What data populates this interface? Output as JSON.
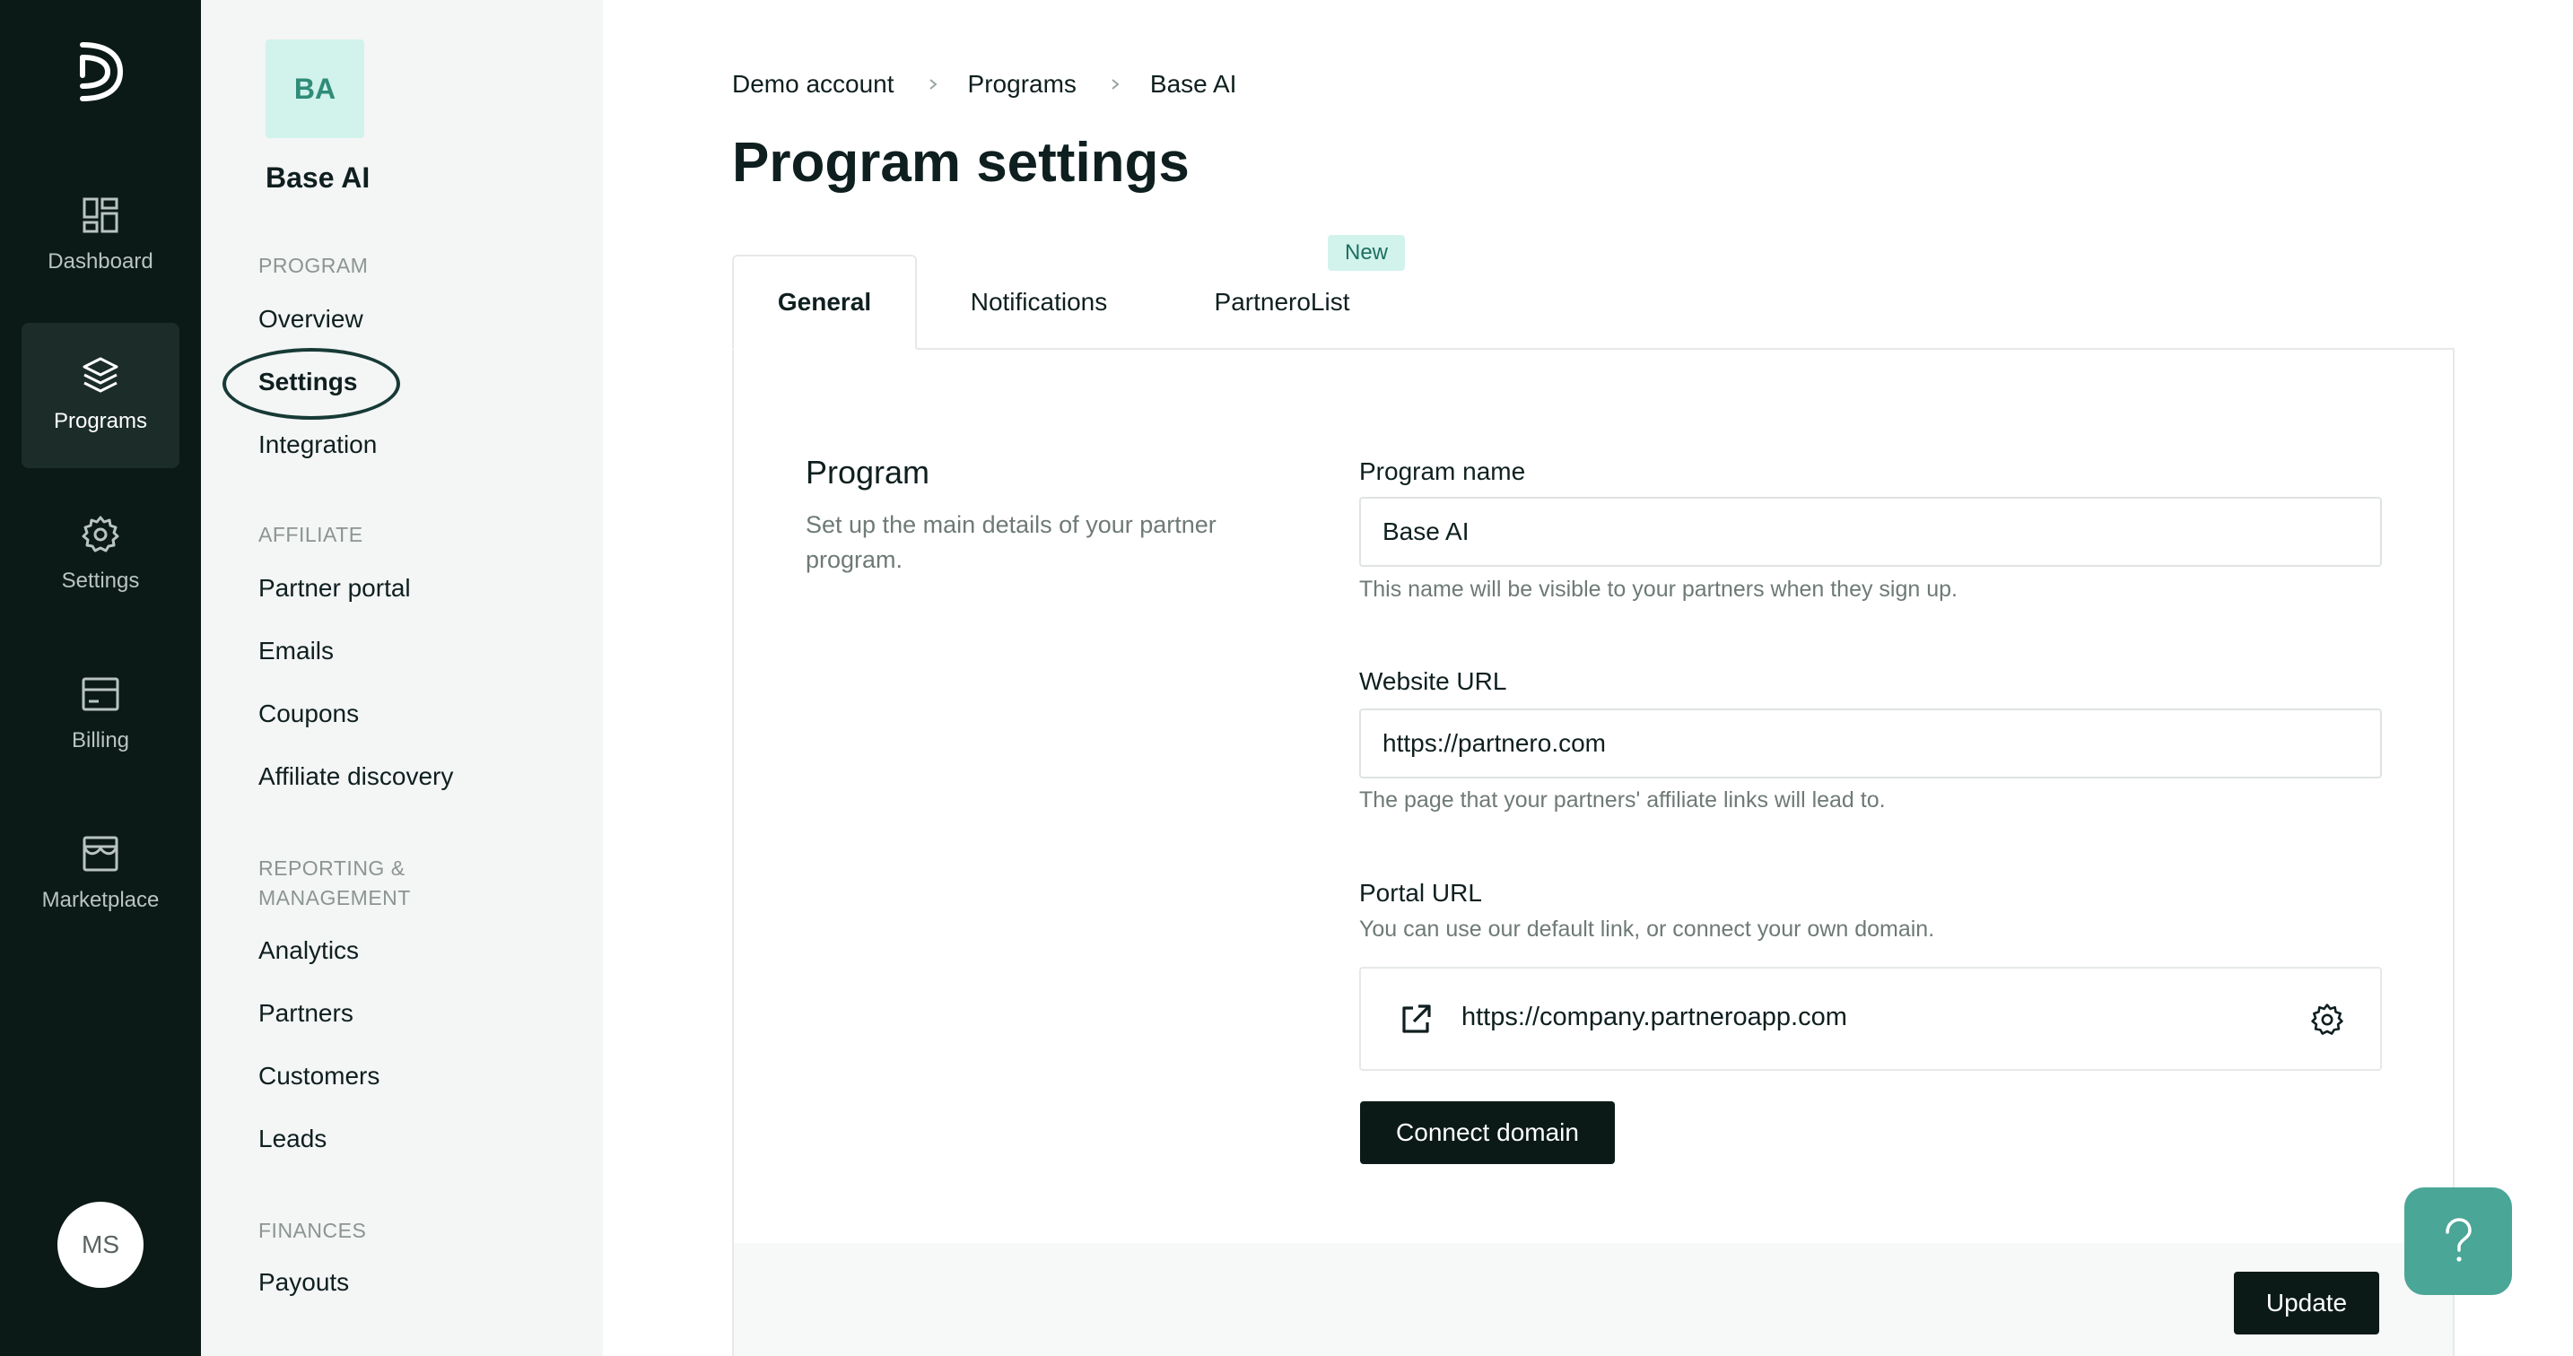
{
  "rail": {
    "items": [
      {
        "label": "Dashboard",
        "icon": "dashboard-icon",
        "active": false
      },
      {
        "label": "Programs",
        "icon": "layers-icon",
        "active": true
      },
      {
        "label": "Settings",
        "icon": "gear-icon",
        "active": false
      },
      {
        "label": "Billing",
        "icon": "billing-icon",
        "active": false
      },
      {
        "label": "Marketplace",
        "icon": "store-icon",
        "active": false
      }
    ],
    "user_initials": "MS"
  },
  "sidebar": {
    "program_initials": "BA",
    "program_name": "Base AI",
    "sections": [
      {
        "title": "PROGRAM",
        "items": [
          "Overview",
          "Settings",
          "Integration"
        ]
      },
      {
        "title": "AFFILIATE",
        "items": [
          "Partner portal",
          "Emails",
          "Coupons",
          "Affiliate discovery"
        ]
      },
      {
        "title": "REPORTING &",
        "title2": "MANAGEMENT",
        "items": [
          "Analytics",
          "Partners",
          "Customers",
          "Leads"
        ]
      },
      {
        "title": "FINANCES",
        "items": [
          "Payouts"
        ]
      }
    ],
    "active_item": "Settings"
  },
  "breadcrumb": [
    "Demo account",
    "Programs",
    "Base AI"
  ],
  "page_title": "Program settings",
  "tabs": [
    {
      "label": "General",
      "active": true
    },
    {
      "label": "Notifications",
      "active": false
    },
    {
      "label": "PartneroList",
      "active": false,
      "badge": "New"
    }
  ],
  "program_section": {
    "heading": "Program",
    "description": "Set up the main details of your partner program."
  },
  "form": {
    "program_name": {
      "label": "Program name",
      "value": "Base AI",
      "hint": "This name will be visible to your partners when they sign up."
    },
    "website_url": {
      "label": "Website URL",
      "value": "https://partnero.com",
      "hint": "The page that your partners' affiliate links will lead to."
    },
    "portal_url": {
      "label": "Portal URL",
      "hint": "You can use our default link, or connect your own domain.",
      "value": "https://company.partneroapp.com"
    },
    "connect_domain_label": "Connect domain",
    "update_label": "Update"
  },
  "help": {
    "glyph": "?"
  },
  "colors": {
    "rail_bg": "#0b1a17",
    "accent": "#4aa697",
    "badge_bg": "#d1f3ec"
  }
}
